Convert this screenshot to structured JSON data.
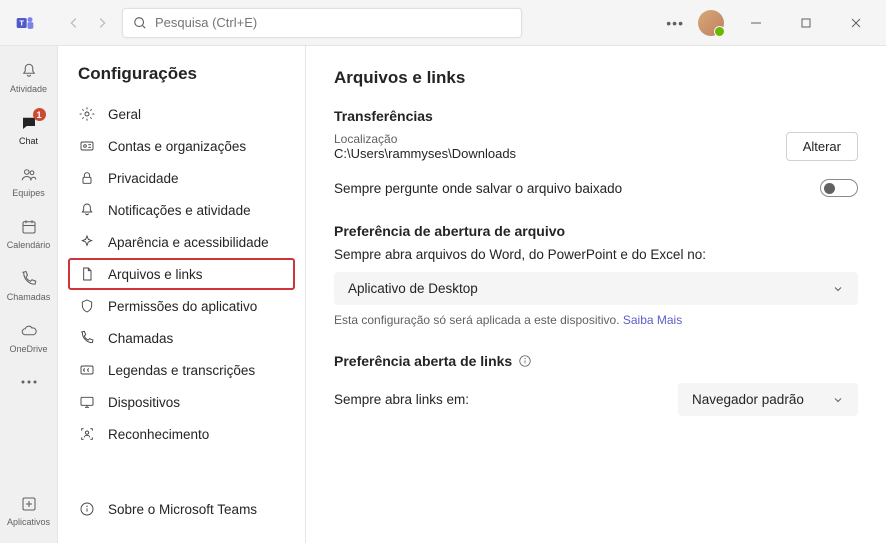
{
  "search": {
    "placeholder": "Pesquisa (Ctrl+E)"
  },
  "rail": {
    "activity": "Atividade",
    "chat": "Chat",
    "chat_badge": "1",
    "teams": "Equipes",
    "calendar": "Calendário",
    "calls": "Chamadas",
    "onedrive": "OneDrive",
    "apps": "Aplicativos"
  },
  "settings": {
    "title": "Configurações",
    "items": {
      "general": "Geral",
      "accounts": "Contas e organizações",
      "privacy": "Privacidade",
      "notifications": "Notificações e atividade",
      "appearance": "Aparência e acessibilidade",
      "files": "Arquivos e links",
      "permissions": "Permissões do aplicativo",
      "calls": "Chamadas",
      "captions": "Legendas e transcrições",
      "devices": "Dispositivos",
      "recognition": "Reconhecimento"
    },
    "about": "Sobre o Microsoft Teams"
  },
  "content": {
    "heading": "Arquivos e links",
    "downloads": {
      "title": "Transferências",
      "location_label": "Localização",
      "location_path": "C:\\Users\\rammyses\\Downloads",
      "change_btn": "Alterar",
      "ask_text": "Sempre pergunte onde salvar o arquivo baixado"
    },
    "open_pref": {
      "title": "Preferência de abertura de arquivo",
      "desc": "Sempre abra arquivos do Word, do PowerPoint e do Excel no:",
      "select_value": "Aplicativo de Desktop",
      "note_text": "Esta configuração só será aplicada a este dispositivo. ",
      "note_link": "Saiba Mais"
    },
    "links_pref": {
      "title": "Preferência aberta de links",
      "desc": "Sempre abra links em:",
      "select_value": "Navegador padrão"
    }
  }
}
